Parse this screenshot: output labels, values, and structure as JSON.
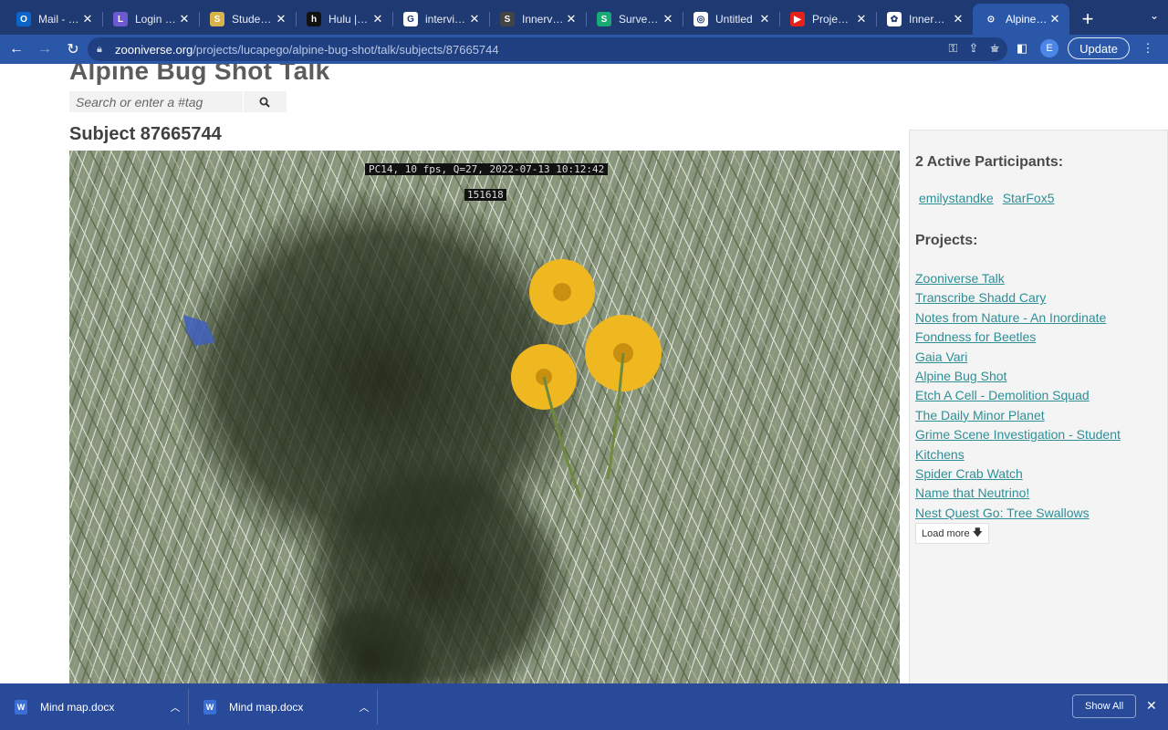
{
  "browser": {
    "tabs": [
      {
        "title": "Mail - Stanford",
        "favicon": "outlook-icon",
        "color": "#0a64c9",
        "glyph": "O"
      },
      {
        "title": "Login - N",
        "favicon": "login-icon",
        "color": "#6d5ad0",
        "glyph": "L"
      },
      {
        "title": "Student Portal",
        "favicon": "student-icon",
        "color": "#d8b24a",
        "glyph": "S"
      },
      {
        "title": "Hulu | Watch",
        "favicon": "hulu-icon",
        "color": "#111111",
        "glyph": "h"
      },
      {
        "title": "interview",
        "favicon": "google-icon",
        "color": "#ffffff",
        "glyph": "G"
      },
      {
        "title": "Innerview",
        "favicon": "innerview-icon",
        "color": "#444444",
        "glyph": "S"
      },
      {
        "title": "SurveyMonkey",
        "favicon": "surveymonkey-icon",
        "color": "#19a974",
        "glyph": "S"
      },
      {
        "title": "Untitled",
        "favicon": "globe-icon",
        "color": "#ffffff",
        "glyph": "◎"
      },
      {
        "title": "Projects on YouTube",
        "favicon": "youtube-icon",
        "color": "#e62117",
        "glyph": "▶"
      },
      {
        "title": "InnerView",
        "favicon": "innerview-app-icon",
        "color": "#ffffff",
        "glyph": "✿"
      },
      {
        "title": "Alpine Bug Shot",
        "favicon": "zooniverse-icon",
        "color": "#2b57a8",
        "glyph": "⊙",
        "active": true
      }
    ],
    "url_host": "zooniverse.org",
    "url_path": "/projects/lucapego/alpine-bug-shot/talk/subjects/87665744",
    "profile_initial": "E",
    "update_label": "Update"
  },
  "page": {
    "site_title": "Alpine Bug Shot Talk",
    "search_placeholder": "Search or enter a #tag",
    "subject_title": "Subject 87665744",
    "photo_overlay_line1": "PC14, 10 fps, Q=27, 2022-07-13 10:12:42",
    "photo_overlay_line2": "151618"
  },
  "sidebar": {
    "participants_heading": "2 Active Participants:",
    "participants": [
      "emilystandke",
      "StarFox5"
    ],
    "projects_heading": "Projects:",
    "projects": [
      "Zooniverse Talk",
      "Transcribe Shadd Cary",
      "Notes from Nature - An Inordinate",
      "Fondness for Beetles",
      "Gaia Vari",
      "Alpine Bug Shot",
      "Etch A Cell - Demolition Squad",
      "The Daily Minor Planet",
      "Grime Scene Investigation - Student",
      "Kitchens",
      "Spider Crab Watch",
      "Name that Neutrino!",
      "Nest Quest Go: Tree Swallows"
    ],
    "load_more_label": "Load more"
  },
  "downloads": {
    "items": [
      {
        "name": "Mind map.docx"
      },
      {
        "name": "Mind map.docx"
      }
    ],
    "show_all_label": "Show All"
  }
}
